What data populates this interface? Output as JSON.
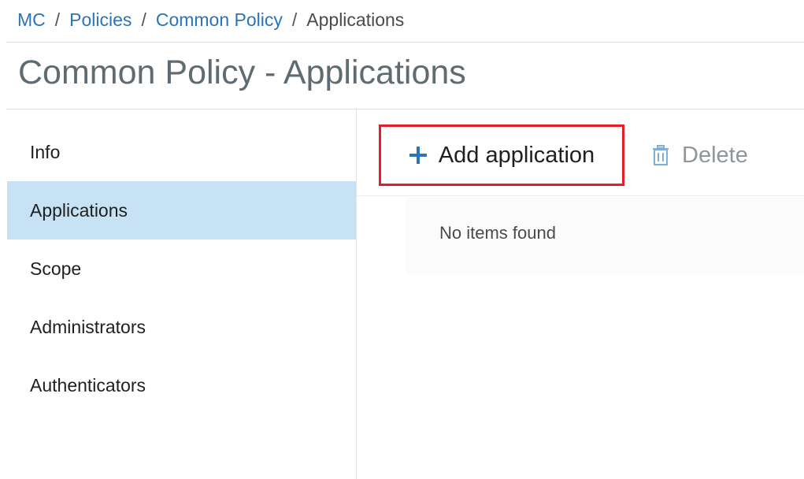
{
  "breadcrumb": {
    "items": [
      "MC",
      "Policies",
      "Common Policy"
    ],
    "separator": "/",
    "current": "Applications",
    "link_color": "#2b74b8"
  },
  "page_title": "Common Policy - Applications",
  "sidebar": {
    "items": [
      {
        "label": "Info",
        "active": false
      },
      {
        "label": "Applications",
        "active": true
      },
      {
        "label": "Scope",
        "active": false
      },
      {
        "label": "Administrators",
        "active": false
      },
      {
        "label": "Authenticators",
        "active": false
      }
    ],
    "active_color": "#c6e2f4"
  },
  "toolbar": {
    "add_label": "Add application",
    "add_icon": "plus-icon",
    "add_highlight_color": "#e31d2a",
    "delete_label": "Delete",
    "delete_icon": "trash-icon"
  },
  "content": {
    "empty_text": "No items found"
  }
}
